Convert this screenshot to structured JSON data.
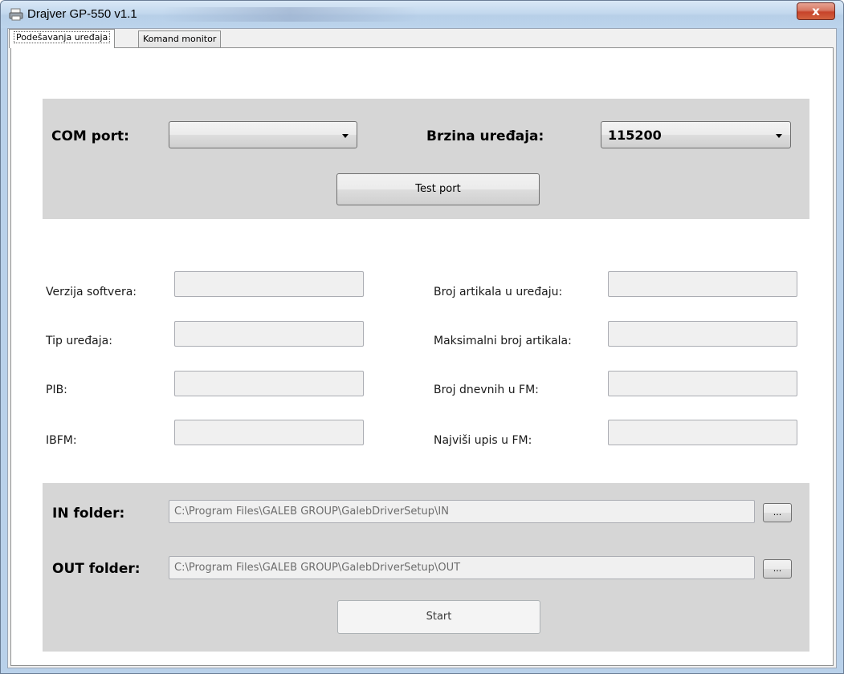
{
  "window": {
    "title": "Drajver GP-550 v1.1",
    "close_label": "x"
  },
  "tabs": [
    {
      "label": "Podešavanja uređaja",
      "active": true
    },
    {
      "label": "Komand monitor",
      "active": false
    }
  ],
  "connection": {
    "com_port_label": "COM port:",
    "com_port_value": "",
    "speed_label": "Brzina uređaja:",
    "speed_value": "115200",
    "test_button": "Test port"
  },
  "info": {
    "software_version_label": "Verzija softvera:",
    "device_type_label": "Tip uređaja:",
    "pib_label": "PIB:",
    "ibfm_label": "IBFM:",
    "article_count_label": "Broj artikala u uređaju:",
    "max_articles_label": "Maksimalni broj artikala:",
    "daily_fm_label": "Broj dnevnih u FM:",
    "highest_entry_label": "Najviši upis u FM:",
    "software_version": "",
    "device_type": "",
    "pib": "",
    "ibfm": "",
    "article_count": "",
    "max_articles": "",
    "daily_fm": "",
    "highest_entry": ""
  },
  "folders": {
    "in_label": "IN folder:",
    "in_path": "C:\\Program Files\\GALEB GROUP\\GalebDriverSetup\\IN",
    "out_label": "OUT folder:",
    "out_path": "C:\\Program Files\\GALEB GROUP\\GalebDriverSetup\\OUT",
    "browse_label": "...",
    "start_button": "Start"
  }
}
